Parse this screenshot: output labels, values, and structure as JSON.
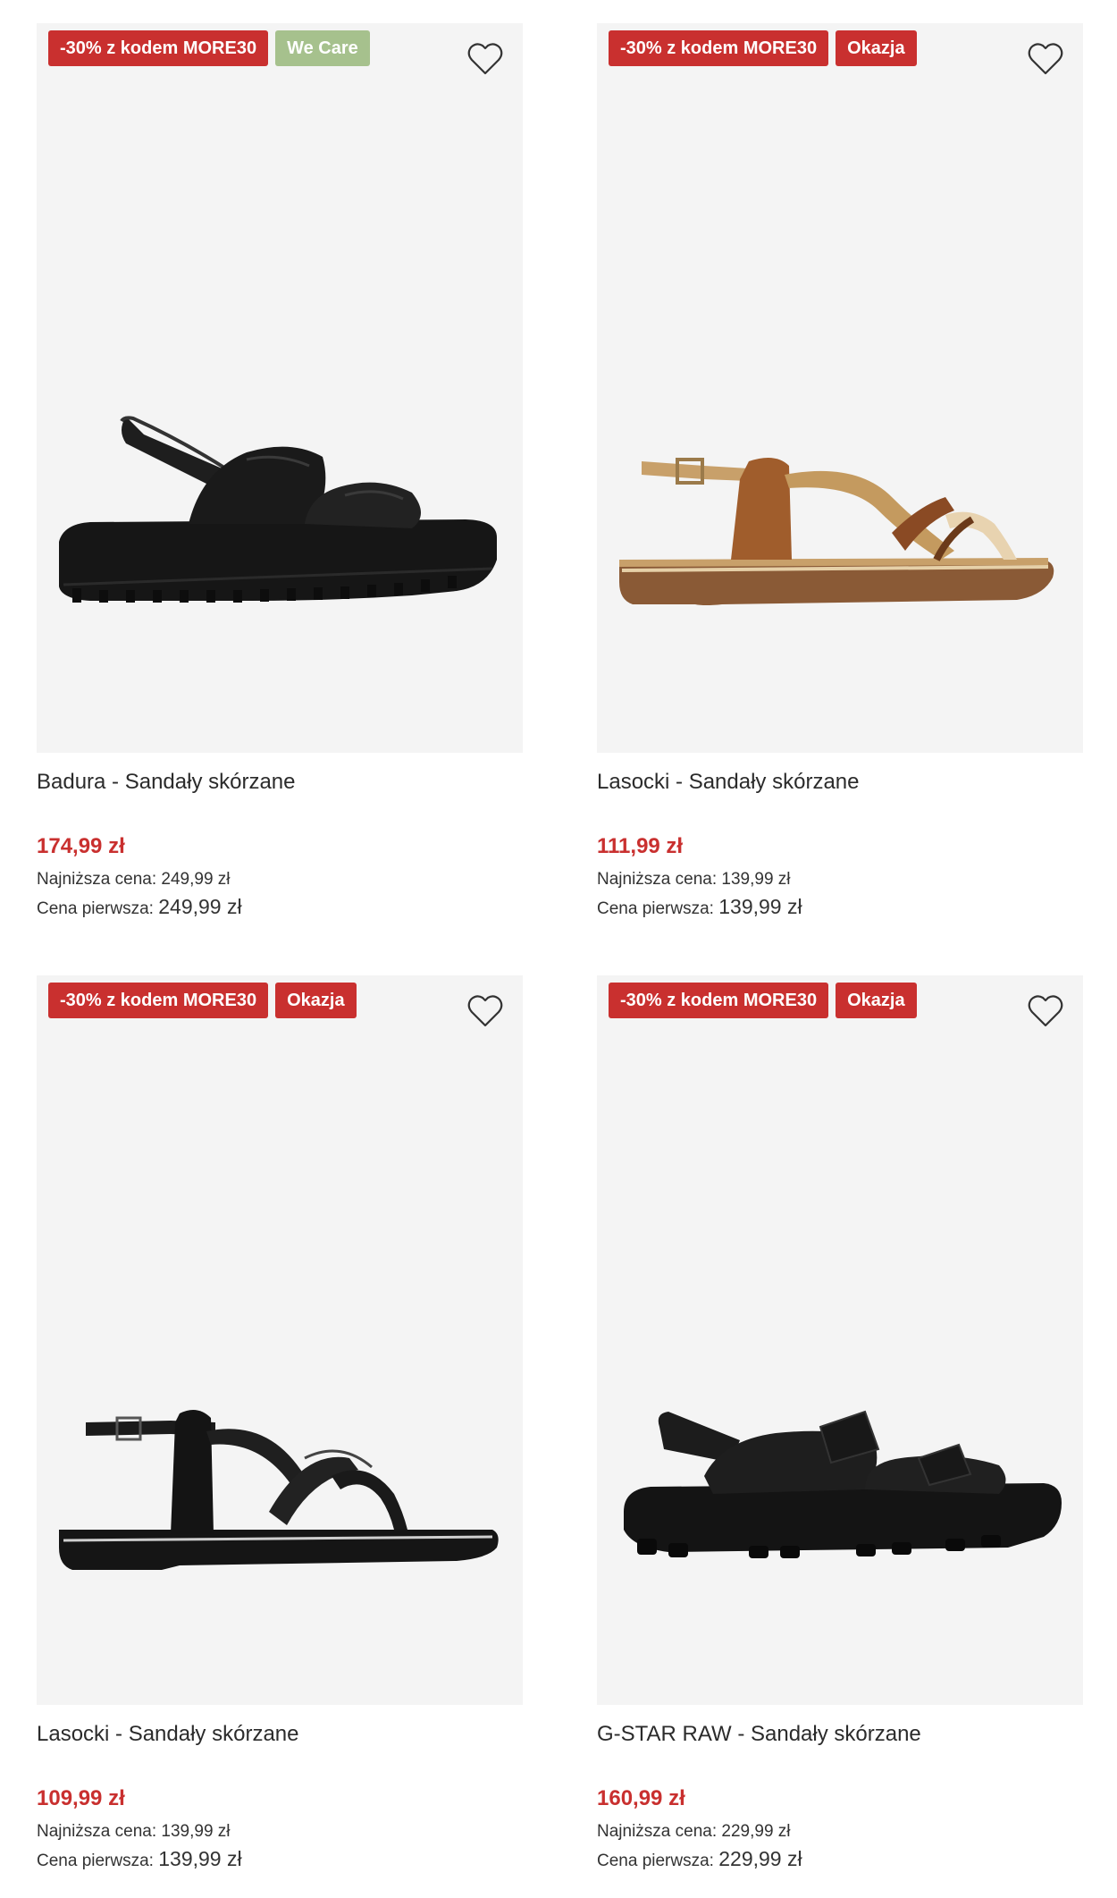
{
  "products": [
    {
      "badges": [
        {
          "label": "-30% z kodem MORE30",
          "type": "promo"
        },
        {
          "label": "We Care",
          "type": "green"
        }
      ],
      "title": "Badura - Sandały skórzane",
      "price": "174,99 zł",
      "lowest_label": "Najniższa cena:",
      "lowest_value": "249,99 zł",
      "first_label": "Cena pierwsza:",
      "first_value": "249,99 zł",
      "image": "black-quilted-strap-sandal"
    },
    {
      "badges": [
        {
          "label": "-30% z kodem MORE30",
          "type": "promo"
        },
        {
          "label": "Okazja",
          "type": "red"
        }
      ],
      "title": "Lasocki - Sandały skórzane",
      "price": "111,99 zł",
      "lowest_label": "Najniższa cena:",
      "lowest_value": "139,99 zł",
      "first_label": "Cena pierwsza:",
      "first_value": "139,99 zł",
      "image": "brown-gold-strappy-sandal"
    },
    {
      "badges": [
        {
          "label": "-30% z kodem MORE30",
          "type": "promo"
        },
        {
          "label": "Okazja",
          "type": "red"
        }
      ],
      "title": "Lasocki - Sandały skórzane",
      "price": "109,99 zł",
      "lowest_label": "Najniższa cena:",
      "lowest_value": "139,99 zł",
      "first_label": "Cena pierwsza:",
      "first_value": "139,99 zł",
      "image": "black-strappy-sandal"
    },
    {
      "badges": [
        {
          "label": "-30% z kodem MORE30",
          "type": "promo"
        },
        {
          "label": "Okazja",
          "type": "red"
        }
      ],
      "title": "G-STAR RAW - Sandały skórzane",
      "price": "160,99 zł",
      "lowest_label": "Najniższa cena:",
      "lowest_value": "229,99 zł",
      "first_label": "Cena pierwsza:",
      "first_value": "229,99 zł",
      "image": "black-sport-velcro-sandal"
    }
  ],
  "colors": {
    "promo": "#c9302f",
    "green": "#a6c18d",
    "price": "#c9302f",
    "image_bg": "#f4f4f4"
  }
}
